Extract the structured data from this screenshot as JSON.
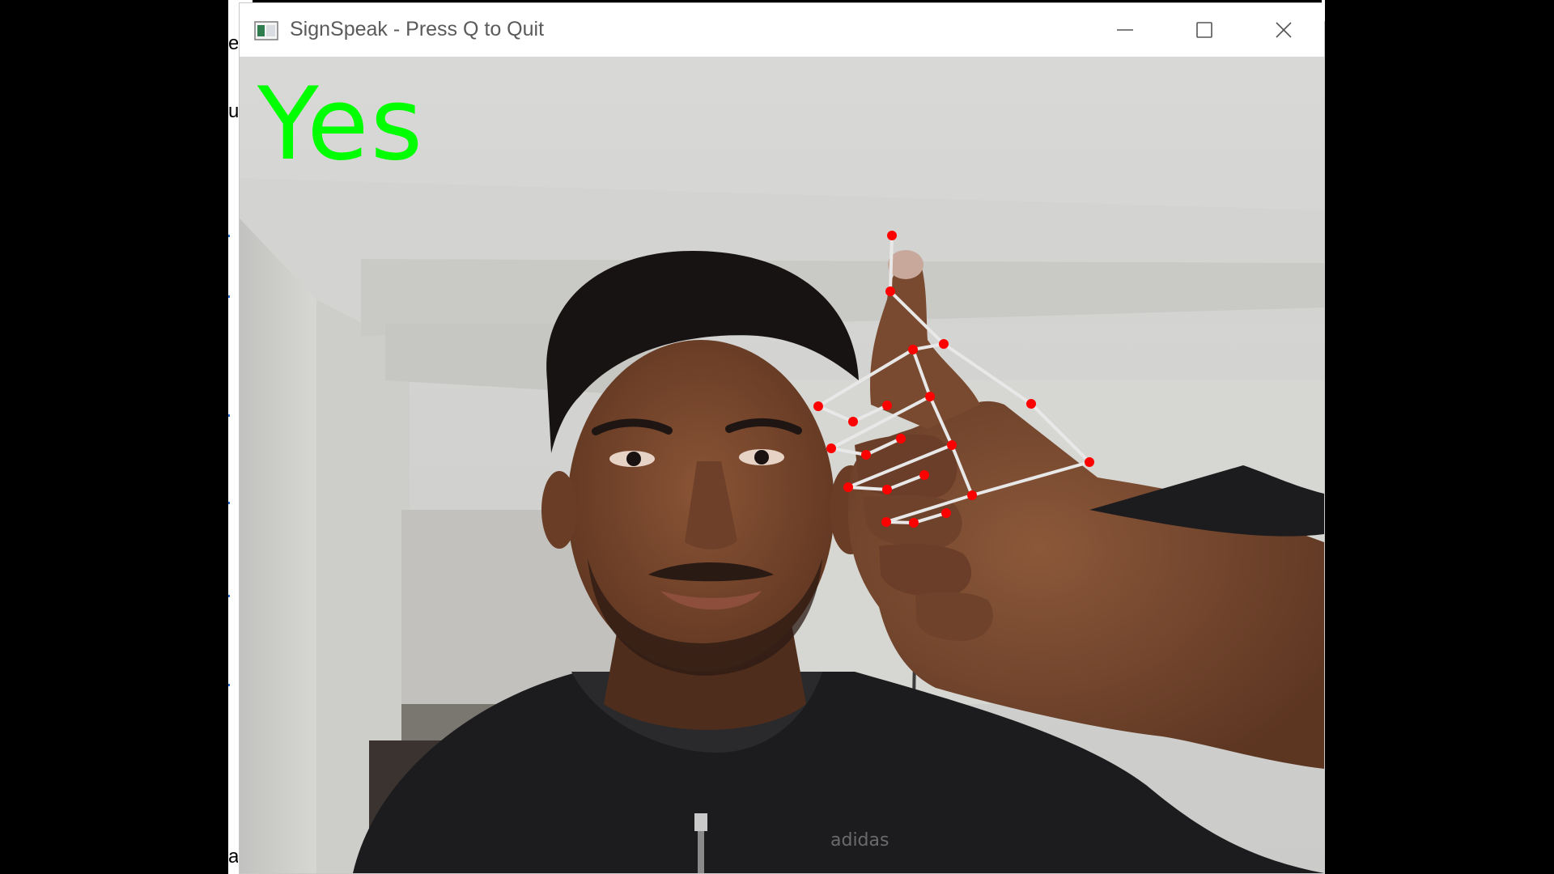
{
  "window": {
    "title": "SignSpeak - Press Q to Quit",
    "controls": [
      "minimize",
      "maximize",
      "close"
    ]
  },
  "background_window": {
    "fragments": [
      "e",
      "u",
      "a"
    ]
  },
  "camera": {
    "prediction_label": "Yes",
    "prediction_color": "#00ff00",
    "landmark_color": "#ff0000",
    "connection_color": "#e8e8e8",
    "landmark_count": 21
  },
  "icons": {
    "app": "opencv-window-icon",
    "minimize": "minimize-icon",
    "maximize": "maximize-icon",
    "close": "close-icon"
  }
}
